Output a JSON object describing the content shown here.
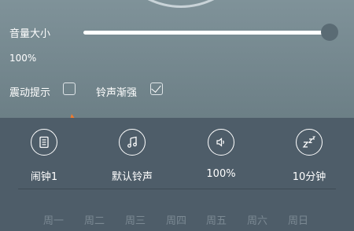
{
  "volume": {
    "label": "音量大小",
    "value_text": "100%",
    "level": 1.0
  },
  "vibrate": {
    "label": "震动提示",
    "checked": false
  },
  "ringtone_fade": {
    "label": "铃声渐强",
    "checked": true
  },
  "controls": [
    {
      "icon": "note-list-icon",
      "label": "闹钟1"
    },
    {
      "icon": "music-note-icon",
      "label": "默认铃声"
    },
    {
      "icon": "speaker-volume-icon",
      "label": "100%"
    },
    {
      "icon": "snooze-zzz-icon",
      "label": "10分钟"
    }
  ],
  "weekdays": [
    "周一",
    "周二",
    "周三",
    "周四",
    "周五",
    "周六",
    "周日"
  ],
  "colors": {
    "accent_arrow": "#f07a2e",
    "panel_top": "#7f9299",
    "panel_bottom": "#4e5d69"
  }
}
